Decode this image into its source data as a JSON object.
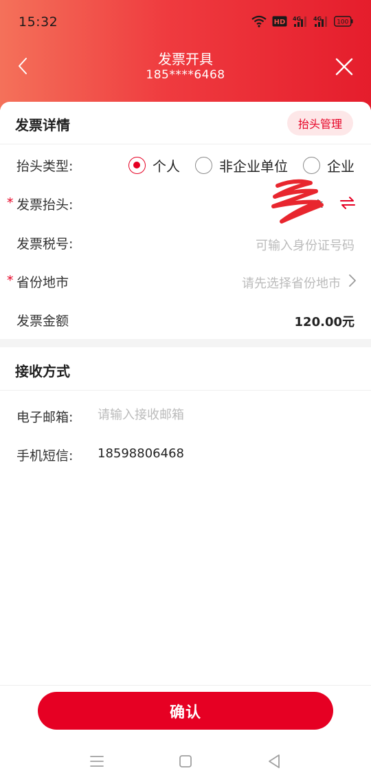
{
  "status_bar": {
    "time": "15:32",
    "icons": [
      "wifi-icon",
      "hd-icon",
      "signal-4g-icon",
      "signal-4g-icon",
      "battery-icon"
    ],
    "hd_label": "HD",
    "net_label_1": "4G",
    "net_label_2": "4G",
    "battery_level": "100"
  },
  "nav": {
    "title": "发票开具",
    "subtitle": "185****6468",
    "back_icon": "chevron-left-icon",
    "close_icon": "close-icon"
  },
  "invoice_details": {
    "section_title": "发票详情",
    "header_mgmt_button": "抬头管理",
    "header_type_label": "抬头类型:",
    "header_type_options": [
      {
        "label": "个人",
        "selected": true
      },
      {
        "label": "非企业单位",
        "selected": false
      },
      {
        "label": "企业",
        "selected": false
      }
    ],
    "required_mark": "*",
    "invoice_header_label": "发票抬头:",
    "invoice_header_value_visible": "k",
    "tax_no_label": "发票税号:",
    "tax_no_placeholder": "可输入身份证号码",
    "region_label": "省份地市",
    "region_placeholder": "请先选择省份地市",
    "amount_label": "发票金额",
    "amount_value": "120.00元"
  },
  "receive": {
    "section_title": "接收方式",
    "email_label": "电子邮箱:",
    "email_placeholder": "请输入接收邮箱",
    "sms_label": "手机短信:",
    "sms_value": "18598806468"
  },
  "confirm_label": "确认",
  "colors": {
    "accent": "#e60023",
    "header_gradient_start": "#f4715a",
    "header_gradient_end": "#e51d2c",
    "scribble": "#e8262e"
  },
  "system_nav": [
    "menu-icon",
    "home-square-icon",
    "back-triangle-icon"
  ]
}
